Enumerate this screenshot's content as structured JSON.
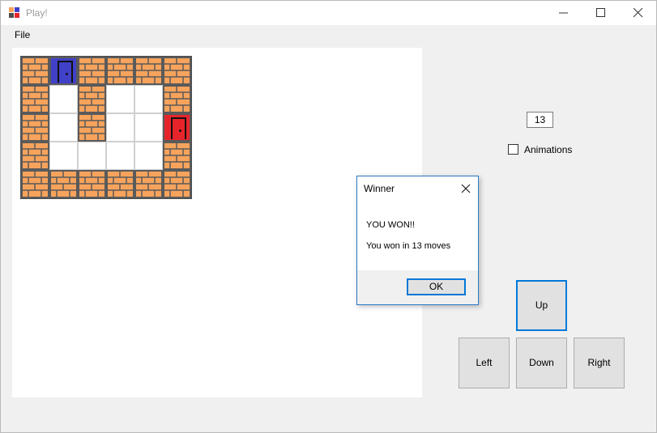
{
  "window": {
    "title": "Play!"
  },
  "menu": {
    "file_label": "File"
  },
  "board": {
    "rows": [
      [
        "brick",
        "door-blue",
        "brick",
        "brick",
        "brick",
        "brick"
      ],
      [
        "brick",
        "floor",
        "brick",
        "floor",
        "floor",
        "brick"
      ],
      [
        "brick",
        "floor",
        "brick",
        "floor",
        "floor",
        "door-red"
      ],
      [
        "brick",
        "floor",
        "floor",
        "floor",
        "floor",
        "brick"
      ],
      [
        "brick",
        "brick",
        "brick",
        "brick",
        "brick",
        "brick"
      ]
    ]
  },
  "controls": {
    "move_count": "13",
    "animations_label": "Animations",
    "animations_checked": false,
    "up_label": "Up",
    "left_label": "Left",
    "down_label": "Down",
    "right_label": "Right"
  },
  "dialog": {
    "title": "Winner",
    "message_line1": "YOU WON!!",
    "message_line2": "You won in 13 moves",
    "ok_label": "OK"
  },
  "colors": {
    "brick": "#f7a35c",
    "mortar": "#5a5a5a",
    "door_blue": "#4040c8",
    "door_red": "#e8242b",
    "focus": "#0078d7"
  }
}
